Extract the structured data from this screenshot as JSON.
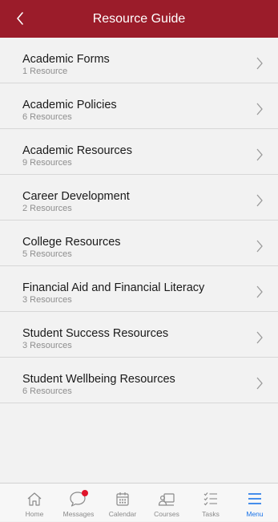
{
  "header": {
    "title": "Resource Guide",
    "back_icon": "chevron-left-icon",
    "background": "#9b1c2a"
  },
  "list": {
    "items": [
      {
        "title": "Academic Forms",
        "subtitle": "1 Resource"
      },
      {
        "title": "Academic Policies",
        "subtitle": "6 Resources"
      },
      {
        "title": "Academic Resources",
        "subtitle": "9 Resources"
      },
      {
        "title": "Career Development",
        "subtitle": "2 Resources"
      },
      {
        "title": "College Resources",
        "subtitle": "5 Resources"
      },
      {
        "title": "Financial Aid and Financial Literacy",
        "subtitle": "3 Resources"
      },
      {
        "title": "Student Success Resources",
        "subtitle": "3 Resources"
      },
      {
        "title": "Student Wellbeing Resources",
        "subtitle": "6 Resources"
      }
    ]
  },
  "tabbar": {
    "tabs": [
      {
        "label": "Home",
        "icon": "home-icon"
      },
      {
        "label": "Messages",
        "icon": "chat-bubble-icon",
        "badge": true
      },
      {
        "label": "Calendar",
        "icon": "calendar-icon"
      },
      {
        "label": "Courses",
        "icon": "courses-icon"
      },
      {
        "label": "Tasks",
        "icon": "tasks-checklist-icon"
      },
      {
        "label": "Menu",
        "icon": "menu-hamburger-icon",
        "active": true
      }
    ],
    "active_color": "#1a73e8",
    "badge_color": "#e0142b"
  }
}
